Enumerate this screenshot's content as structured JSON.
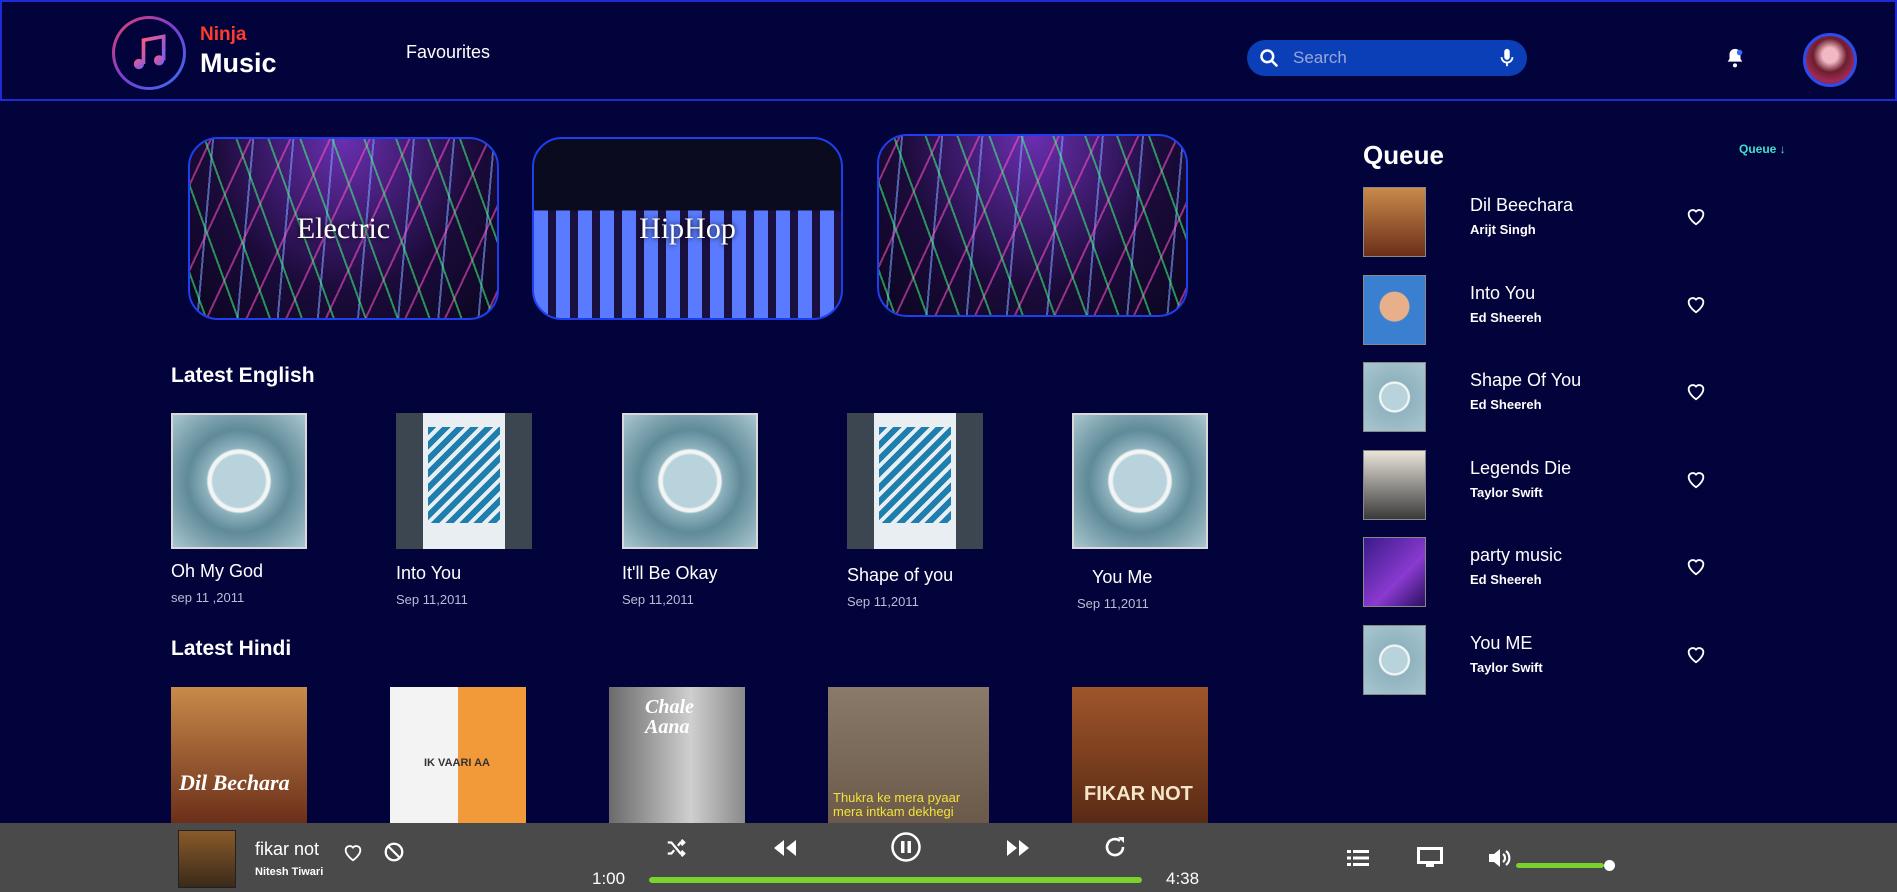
{
  "header": {
    "brand_top": "Ninja",
    "brand_bottom": "Music",
    "nav_favourites": "Favourites",
    "search_placeholder": "Search"
  },
  "genres": [
    {
      "label": "Electric"
    },
    {
      "label": "HipHop"
    },
    {
      "label": ""
    }
  ],
  "latest_english": {
    "title": "Latest English",
    "items": [
      {
        "title": "Oh My God",
        "date": "sep 11 ,2011"
      },
      {
        "title": "Into You",
        "date": "Sep 11,2011"
      },
      {
        "title": "It'll Be Okay",
        "date": "Sep 11,2011"
      },
      {
        "title": "Shape of you",
        "date": "Sep 11,2011"
      },
      {
        "title": "You Me",
        "date": "Sep 11,2011"
      }
    ]
  },
  "latest_hindi": {
    "title": "Latest Hindi",
    "items": [
      {
        "art_text": "Dil Bechara"
      },
      {
        "art_text": "IK VAARI AA"
      },
      {
        "art_text": "Chale Aana"
      },
      {
        "art_text": "Thukra ke mera pyaar mera intkam dekhegi"
      },
      {
        "art_text": "FIKAR NOT"
      }
    ]
  },
  "queue": {
    "title": "Queue",
    "link": "Queue ↓",
    "items": [
      {
        "title": "Dil Beechara",
        "artist": "Arijt Singh"
      },
      {
        "title": "Into You",
        "artist": "Ed Sheereh"
      },
      {
        "title": "Shape Of You",
        "artist": "Ed Sheereh"
      },
      {
        "title": "Legends Die",
        "artist": "Taylor Swift"
      },
      {
        "title": "party music",
        "artist": "Ed Sheereh"
      },
      {
        "title": "You ME",
        "artist": "Taylor Swift"
      }
    ]
  },
  "player": {
    "title": "fikar not",
    "artist": "Nitesh Tiwari",
    "elapsed": "1:00",
    "duration": "4:38",
    "progress_fraction": 1.0,
    "volume_fraction": 0.93,
    "accent": "#7ad22c"
  },
  "colors": {
    "background": "#02033a",
    "border_accent": "#1d2bd4",
    "brand_red": "#ff3b2f"
  }
}
